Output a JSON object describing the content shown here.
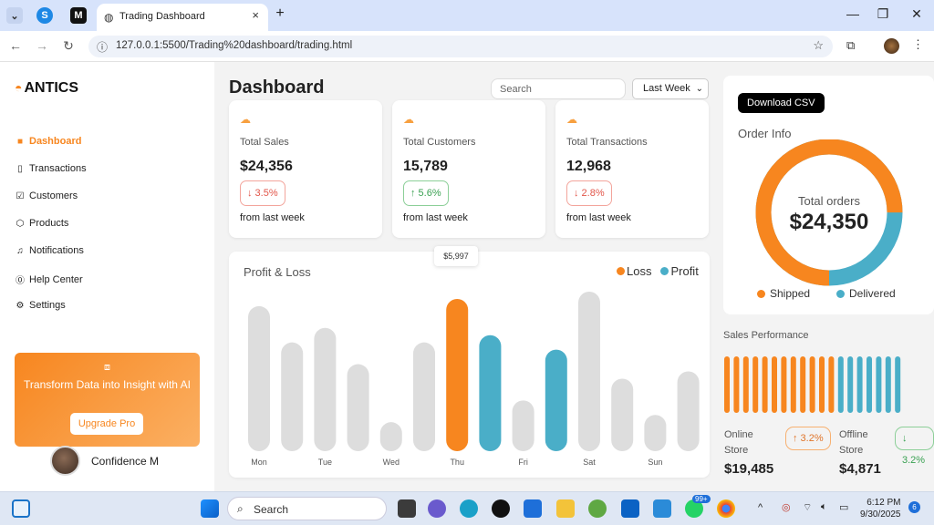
{
  "browser": {
    "tab_title": "Trading Dashboard",
    "url": "127.0.0.1:5500/Trading%20dashboard/trading.html"
  },
  "sidebar": {
    "logo": "ANTICS",
    "items": [
      {
        "label": "Dashboard",
        "icon": "dashboard-icon",
        "active": true
      },
      {
        "label": "Transactions",
        "icon": "phone-icon"
      },
      {
        "label": "Customers",
        "icon": "customers-icon"
      },
      {
        "label": "Products",
        "icon": "box-icon"
      },
      {
        "label": "Notifications",
        "icon": "bell-icon"
      },
      {
        "label": "Help Center",
        "icon": "help-icon"
      },
      {
        "label": "Settings",
        "icon": "gear-icon"
      }
    ],
    "promo": {
      "title": "Transform Data into Insight with AI",
      "button": "Upgrade Pro"
    },
    "user": {
      "name": "Confidence M"
    }
  },
  "header": {
    "title": "Dashboard",
    "search_placeholder": "Search",
    "period": "Last Week"
  },
  "cards": [
    {
      "label": "Total Sales",
      "value": "$24,356",
      "change": "↓ 3.5%",
      "trend": "down",
      "footer": "from last week"
    },
    {
      "label": "Total Customers",
      "value": "15,789",
      "change": "↑ 5.6%",
      "trend": "up",
      "footer": "from last week"
    },
    {
      "label": "Total Transactions",
      "value": "12,968",
      "change": "↓ 2.8%",
      "trend": "down",
      "footer": "from last week"
    }
  ],
  "profit_loss": {
    "title": "Profit & Loss",
    "legend_loss": "Loss",
    "legend_profit": "Profit",
    "tooltip": "$5,997"
  },
  "chart_data": {
    "type": "bar",
    "categories": [
      "Mon",
      "",
      "Tue",
      "",
      "Wed",
      "",
      "Thu",
      "",
      "Fri",
      "",
      "Sat",
      "",
      "Sun",
      ""
    ],
    "values": [
      20,
      15,
      17,
      12,
      4,
      15,
      21,
      16,
      7,
      14,
      22,
      10,
      5,
      11
    ],
    "bar_colors": [
      "#dddddd",
      "#dddddd",
      "#dddddd",
      "#dddddd",
      "#dddddd",
      "#dddddd",
      "#f7861f",
      "#4aaec8",
      "#dddddd",
      "#4aaec8",
      "#dddddd",
      "#dddddd",
      "#dddddd",
      "#dddddd"
    ],
    "ylim": [
      0,
      22
    ],
    "colors": {
      "loss": "#f7861f",
      "profit": "#4aaec8"
    }
  },
  "order_info": {
    "download_label": "Download CSV",
    "title": "Order Info",
    "center_label": "Total orders",
    "center_value": "$24,350",
    "shipped_fraction": 0.75,
    "legend_shipped": "Shipped",
    "legend_delivered": "Delivered"
  },
  "sales_performance": {
    "title": "Sales Performance",
    "orange_bars": 12,
    "blue_bars": 7,
    "online_label": "Online Store",
    "online_value": "$19,485",
    "online_change": "↑ 3.2%",
    "offline_label": "Offline Store",
    "offline_value": "$4,871",
    "offline_change": "↓ 3.2%"
  },
  "taskbar": {
    "search_label": "Search",
    "time": "6:12 PM",
    "date": "9/30/2025",
    "badge_whatsapp": "99+",
    "badge_notif": "6"
  },
  "colors": {
    "accent": "#f7861f",
    "secondary": "#4aaec8"
  }
}
